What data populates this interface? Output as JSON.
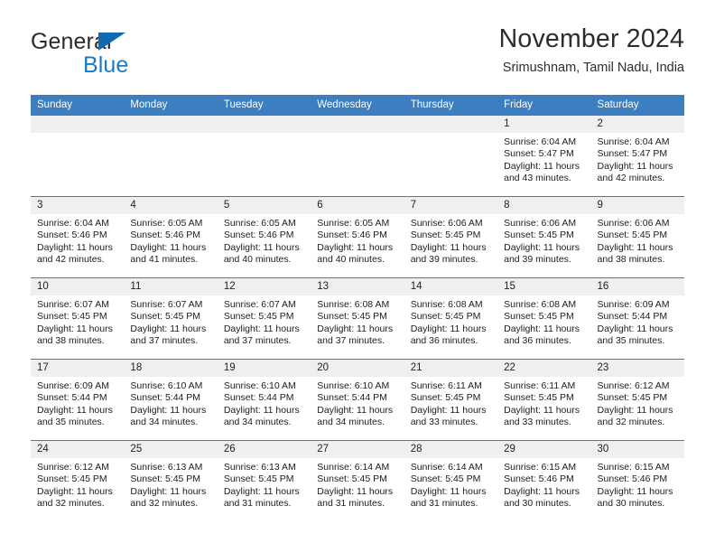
{
  "brand": {
    "line1": "General",
    "line2": "Blue",
    "accent_color": "#1a7bc4",
    "triangle_color": "#1168b3"
  },
  "header": {
    "title": "November 2024",
    "subtitle": "Srimushnam, Tamil Nadu, India"
  },
  "calendar": {
    "header_bg": "#3c7ebf",
    "daynum_bg": "#efefef",
    "weekday_headers": [
      "Sunday",
      "Monday",
      "Tuesday",
      "Wednesday",
      "Thursday",
      "Friday",
      "Saturday"
    ],
    "weeks": [
      [
        {
          "day": "",
          "empty": true,
          "lines": []
        },
        {
          "day": "",
          "empty": true,
          "lines": []
        },
        {
          "day": "",
          "empty": true,
          "lines": []
        },
        {
          "day": "",
          "empty": true,
          "lines": []
        },
        {
          "day": "",
          "empty": true,
          "lines": []
        },
        {
          "day": "1",
          "empty": false,
          "lines": [
            "Sunrise: 6:04 AM",
            "Sunset: 5:47 PM",
            "Daylight: 11 hours",
            "and 43 minutes."
          ]
        },
        {
          "day": "2",
          "empty": false,
          "lines": [
            "Sunrise: 6:04 AM",
            "Sunset: 5:47 PM",
            "Daylight: 11 hours",
            "and 42 minutes."
          ]
        }
      ],
      [
        {
          "day": "3",
          "empty": false,
          "lines": [
            "Sunrise: 6:04 AM",
            "Sunset: 5:46 PM",
            "Daylight: 11 hours",
            "and 42 minutes."
          ]
        },
        {
          "day": "4",
          "empty": false,
          "lines": [
            "Sunrise: 6:05 AM",
            "Sunset: 5:46 PM",
            "Daylight: 11 hours",
            "and 41 minutes."
          ]
        },
        {
          "day": "5",
          "empty": false,
          "lines": [
            "Sunrise: 6:05 AM",
            "Sunset: 5:46 PM",
            "Daylight: 11 hours",
            "and 40 minutes."
          ]
        },
        {
          "day": "6",
          "empty": false,
          "lines": [
            "Sunrise: 6:05 AM",
            "Sunset: 5:46 PM",
            "Daylight: 11 hours",
            "and 40 minutes."
          ]
        },
        {
          "day": "7",
          "empty": false,
          "lines": [
            "Sunrise: 6:06 AM",
            "Sunset: 5:45 PM",
            "Daylight: 11 hours",
            "and 39 minutes."
          ]
        },
        {
          "day": "8",
          "empty": false,
          "lines": [
            "Sunrise: 6:06 AM",
            "Sunset: 5:45 PM",
            "Daylight: 11 hours",
            "and 39 minutes."
          ]
        },
        {
          "day": "9",
          "empty": false,
          "lines": [
            "Sunrise: 6:06 AM",
            "Sunset: 5:45 PM",
            "Daylight: 11 hours",
            "and 38 minutes."
          ]
        }
      ],
      [
        {
          "day": "10",
          "empty": false,
          "lines": [
            "Sunrise: 6:07 AM",
            "Sunset: 5:45 PM",
            "Daylight: 11 hours",
            "and 38 minutes."
          ]
        },
        {
          "day": "11",
          "empty": false,
          "lines": [
            "Sunrise: 6:07 AM",
            "Sunset: 5:45 PM",
            "Daylight: 11 hours",
            "and 37 minutes."
          ]
        },
        {
          "day": "12",
          "empty": false,
          "lines": [
            "Sunrise: 6:07 AM",
            "Sunset: 5:45 PM",
            "Daylight: 11 hours",
            "and 37 minutes."
          ]
        },
        {
          "day": "13",
          "empty": false,
          "lines": [
            "Sunrise: 6:08 AM",
            "Sunset: 5:45 PM",
            "Daylight: 11 hours",
            "and 37 minutes."
          ]
        },
        {
          "day": "14",
          "empty": false,
          "lines": [
            "Sunrise: 6:08 AM",
            "Sunset: 5:45 PM",
            "Daylight: 11 hours",
            "and 36 minutes."
          ]
        },
        {
          "day": "15",
          "empty": false,
          "lines": [
            "Sunrise: 6:08 AM",
            "Sunset: 5:45 PM",
            "Daylight: 11 hours",
            "and 36 minutes."
          ]
        },
        {
          "day": "16",
          "empty": false,
          "lines": [
            "Sunrise: 6:09 AM",
            "Sunset: 5:44 PM",
            "Daylight: 11 hours",
            "and 35 minutes."
          ]
        }
      ],
      [
        {
          "day": "17",
          "empty": false,
          "lines": [
            "Sunrise: 6:09 AM",
            "Sunset: 5:44 PM",
            "Daylight: 11 hours",
            "and 35 minutes."
          ]
        },
        {
          "day": "18",
          "empty": false,
          "lines": [
            "Sunrise: 6:10 AM",
            "Sunset: 5:44 PM",
            "Daylight: 11 hours",
            "and 34 minutes."
          ]
        },
        {
          "day": "19",
          "empty": false,
          "lines": [
            "Sunrise: 6:10 AM",
            "Sunset: 5:44 PM",
            "Daylight: 11 hours",
            "and 34 minutes."
          ]
        },
        {
          "day": "20",
          "empty": false,
          "lines": [
            "Sunrise: 6:10 AM",
            "Sunset: 5:44 PM",
            "Daylight: 11 hours",
            "and 34 minutes."
          ]
        },
        {
          "day": "21",
          "empty": false,
          "lines": [
            "Sunrise: 6:11 AM",
            "Sunset: 5:45 PM",
            "Daylight: 11 hours",
            "and 33 minutes."
          ]
        },
        {
          "day": "22",
          "empty": false,
          "lines": [
            "Sunrise: 6:11 AM",
            "Sunset: 5:45 PM",
            "Daylight: 11 hours",
            "and 33 minutes."
          ]
        },
        {
          "day": "23",
          "empty": false,
          "lines": [
            "Sunrise: 6:12 AM",
            "Sunset: 5:45 PM",
            "Daylight: 11 hours",
            "and 32 minutes."
          ]
        }
      ],
      [
        {
          "day": "24",
          "empty": false,
          "lines": [
            "Sunrise: 6:12 AM",
            "Sunset: 5:45 PM",
            "Daylight: 11 hours",
            "and 32 minutes."
          ]
        },
        {
          "day": "25",
          "empty": false,
          "lines": [
            "Sunrise: 6:13 AM",
            "Sunset: 5:45 PM",
            "Daylight: 11 hours",
            "and 32 minutes."
          ]
        },
        {
          "day": "26",
          "empty": false,
          "lines": [
            "Sunrise: 6:13 AM",
            "Sunset: 5:45 PM",
            "Daylight: 11 hours",
            "and 31 minutes."
          ]
        },
        {
          "day": "27",
          "empty": false,
          "lines": [
            "Sunrise: 6:14 AM",
            "Sunset: 5:45 PM",
            "Daylight: 11 hours",
            "and 31 minutes."
          ]
        },
        {
          "day": "28",
          "empty": false,
          "lines": [
            "Sunrise: 6:14 AM",
            "Sunset: 5:45 PM",
            "Daylight: 11 hours",
            "and 31 minutes."
          ]
        },
        {
          "day": "29",
          "empty": false,
          "lines": [
            "Sunrise: 6:15 AM",
            "Sunset: 5:46 PM",
            "Daylight: 11 hours",
            "and 30 minutes."
          ]
        },
        {
          "day": "30",
          "empty": false,
          "lines": [
            "Sunrise: 6:15 AM",
            "Sunset: 5:46 PM",
            "Daylight: 11 hours",
            "and 30 minutes."
          ]
        }
      ]
    ]
  }
}
